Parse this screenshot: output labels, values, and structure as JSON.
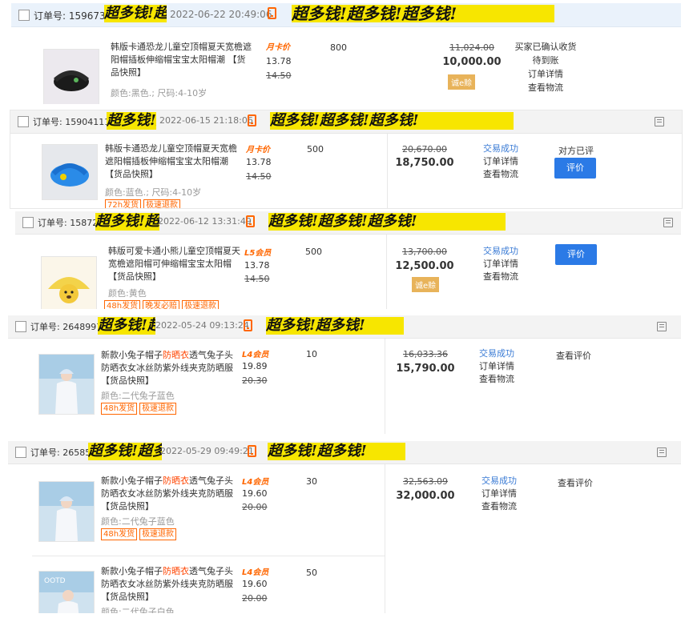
{
  "scribble": {
    "o1": "超多钱!超多钱!超多钱!",
    "o2": "超多钱!超多钱!超多钱!",
    "o3": "超多钱!超多钱!超多钱!",
    "o4": "超多钱!超多钱!",
    "o5": "超多钱!超多钱!"
  },
  "orders": [
    {
      "order_label": "订单号: 159673",
      "time": "2022-06-22 20:49:06",
      "title": "韩版卡通恐龙儿童空顶帽夏天宽檐遮阳帽插板伸缩帽宝宝太阳帽潮 【货品快照】",
      "spec": "颜色:黑色.; 尺码:4-10岁",
      "member": "月卡价",
      "price": "13.78",
      "old_price": "14.50",
      "qty": "800",
      "orig_total": "11,024.00",
      "total": "10,000.00",
      "badge": "诚e赊",
      "status": "买家已确认收货",
      "links": [
        "待到账",
        "订单详情",
        "查看物流"
      ]
    },
    {
      "order_label": "订单号: 159041118",
      "time": "2022-06-15 21:18:06",
      "title": "韩版卡通恐龙儿童空顶帽夏天宽檐遮阳帽插板伸缩帽宝宝太阳帽潮 【货品快照】",
      "spec": "颜色:蓝色.; 尺码:4-10岁",
      "tags": [
        "72h发货",
        "极速退款"
      ],
      "member": "月卡价",
      "price": "13.78",
      "old_price": "14.50",
      "qty": "500",
      "orig_total": "20,670.00",
      "total": "18,750.00",
      "status": "交易成功",
      "links": [
        "订单详情",
        "查看物流"
      ],
      "review_text": "对方已评",
      "button": "评价"
    },
    {
      "order_label": "订单号: 158721",
      "time": "2022-06-12 13:31:49",
      "title": "韩版可爱卡通小熊儿童空顶帽夏天宽檐遮阳帽可伸缩帽宝宝太阳帽 【货品快照】",
      "spec": "颜色:黄色",
      "tags": [
        "48h发货",
        "晚发必赔",
        "极速退款"
      ],
      "member": "L5会员",
      "price": "13.78",
      "old_price": "14.50",
      "qty": "500",
      "orig_total": "13,700.00",
      "total": "12,500.00",
      "badge": "诚e赊",
      "status": "交易成功",
      "links": [
        "订单详情",
        "查看物流"
      ],
      "button": "评价"
    },
    {
      "order_label": "订单号: 26489971",
      "time": "2022-05-24 09:13:24",
      "title_a": "新款小兔子帽子",
      "title_red": "防晒衣",
      "title_b": "透气兔子头防晒衣女冰丝防紫外线夹克防晒服 【货品快照】",
      "spec": "颜色:二代兔子蓝色",
      "tags": [
        "48h发货",
        "极速退款"
      ],
      "member": "L4会员",
      "price": "19.89",
      "old_price": "20.30",
      "qty": "10",
      "orig_total": "16,033.36",
      "total": "15,790.00",
      "status": "交易成功",
      "links": [
        "订单详情",
        "查看物流"
      ],
      "review_text": "查看评价"
    },
    {
      "order_label": "订单号: 26585",
      "time": "2022-05-29 09:49:21",
      "items": [
        {
          "title_a": "新款小兔子帽子",
          "title_red": "防晒衣",
          "title_b": "透气兔子头防晒衣女冰丝防紫外线夹克防晒服 【货品快照】",
          "spec": "颜色:二代兔子蓝色",
          "tags": [
            "48h发货",
            "极速退款"
          ],
          "member": "L4会员",
          "price": "19.60",
          "old_price": "20.00",
          "qty": "30"
        },
        {
          "title_a": "新款小兔子帽子",
          "title_red": "防晒衣",
          "title_b": "透气兔子头防晒衣女冰丝防紫外线夹克防晒服 【货品快照】",
          "spec": "颜色:二代兔子白色",
          "member": "L4会员",
          "price": "19.60",
          "old_price": "20.00",
          "qty": "50"
        }
      ],
      "orig_total": "32,563.09",
      "total": "32,000.00",
      "status": "交易成功",
      "links": [
        "订单详情",
        "查看物流"
      ],
      "review_text": "查看评价"
    }
  ]
}
